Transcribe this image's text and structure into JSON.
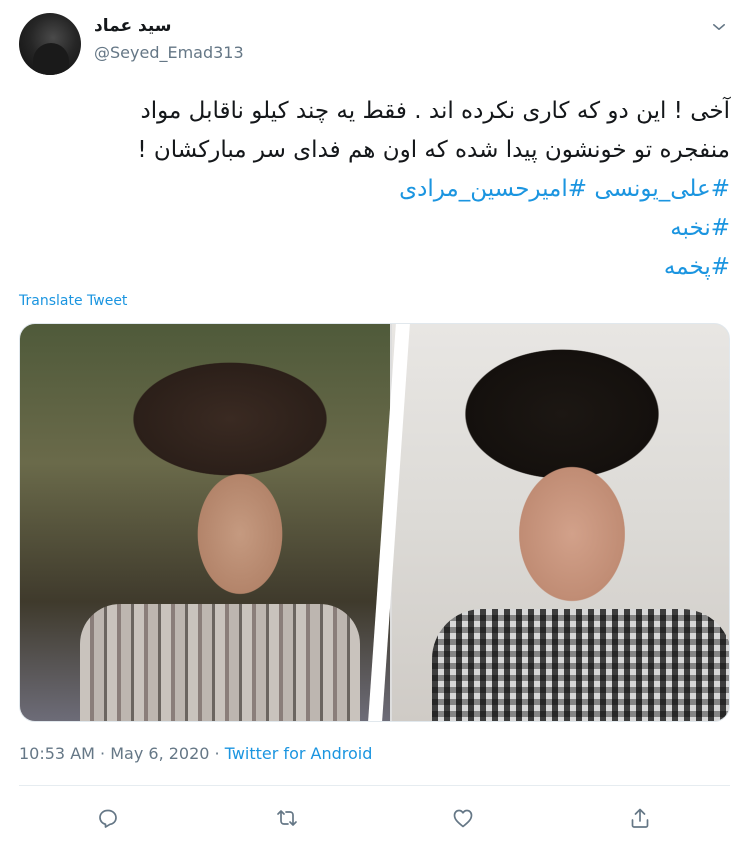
{
  "user": {
    "display_name": "سید عماد",
    "handle": "@Seyed_Emad313"
  },
  "tweet": {
    "lines": [
      "آخی ! این دو که کاری نکرده اند . فقط یه چند کیلو ناقابل مواد",
      "منفجره تو خونشون پیدا شده که اون هم فدای سر مبارکشان !"
    ],
    "hashtags_line1": [
      "#علی_یونسی",
      "#امیرحسین_مرادی"
    ],
    "hashtags_line2": "#نخبه",
    "hashtags_line3": "#پخمه"
  },
  "translate_label": "Translate Tweet",
  "meta": {
    "time": "10:53 AM",
    "separator": " · ",
    "date": "May 6, 2020",
    "source": "Twitter for Android"
  },
  "icons": {
    "menu": "chevron-down-icon",
    "reply": "reply-icon",
    "retweet": "retweet-icon",
    "like": "heart-icon",
    "share": "share-icon"
  },
  "colors": {
    "link": "#1b95e0",
    "secondary_text": "#657786",
    "primary_text": "#14171a"
  }
}
